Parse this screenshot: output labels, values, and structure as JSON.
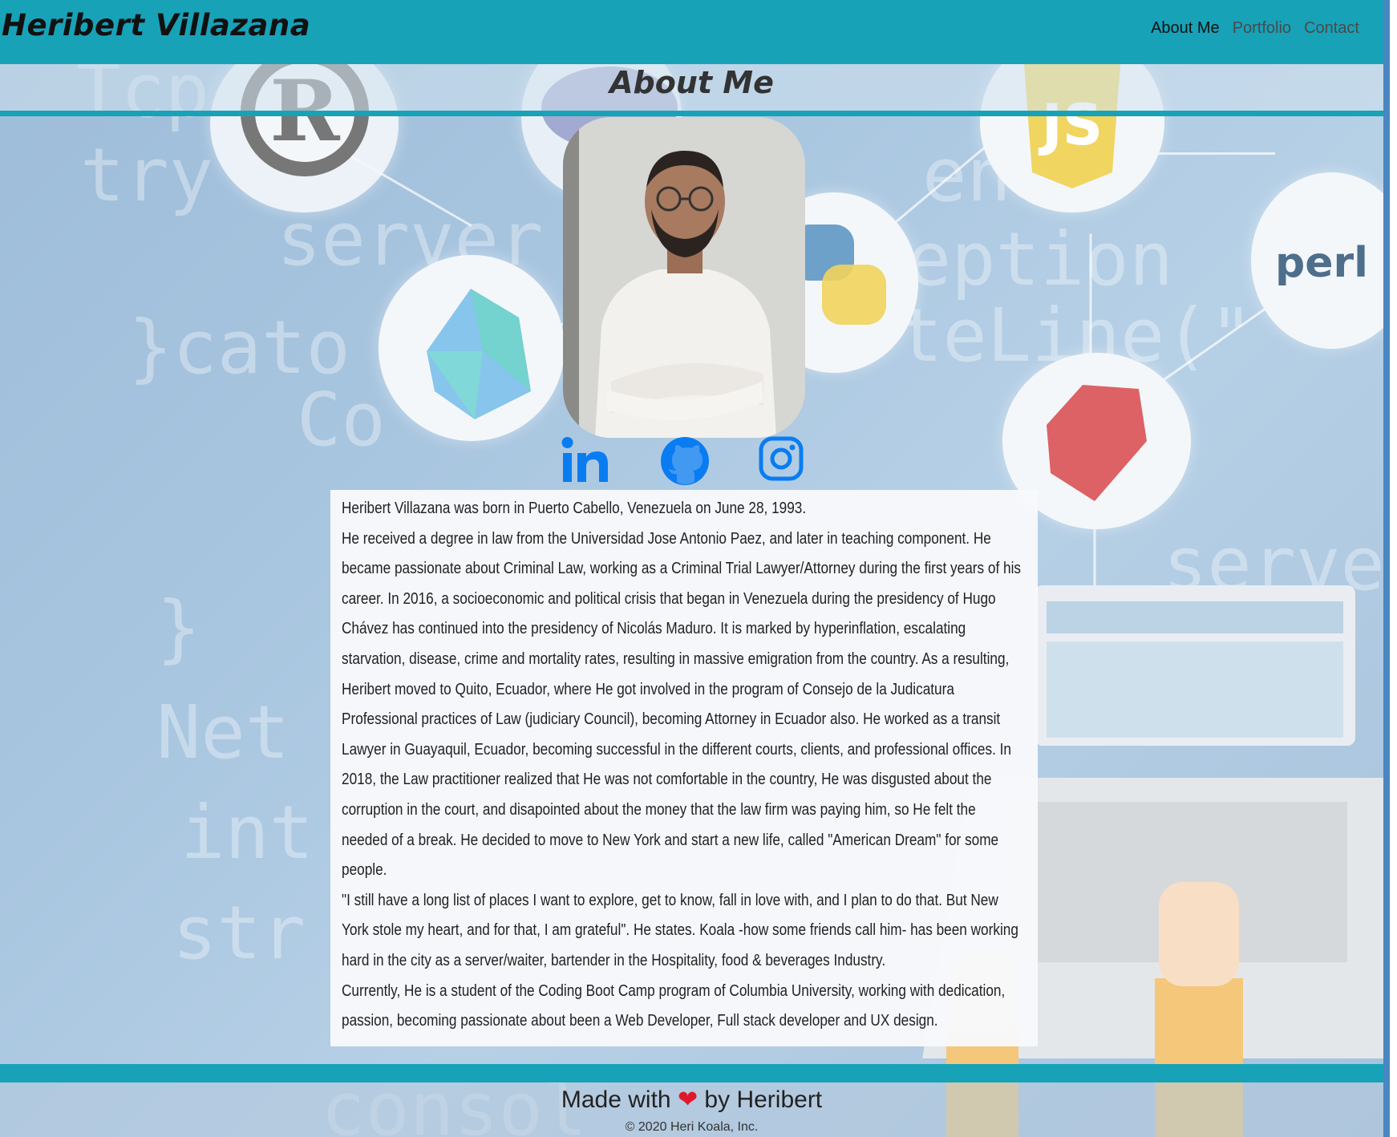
{
  "header": {
    "brand": "Heribert Villazana",
    "nav": [
      {
        "label": "About Me",
        "active": true
      },
      {
        "label": "Portfolio",
        "active": false
      },
      {
        "label": "Contact",
        "active": false
      }
    ]
  },
  "main": {
    "title": "About Me",
    "socials": [
      {
        "icon": "linkedin-icon"
      },
      {
        "icon": "github-icon"
      },
      {
        "icon": "instagram-icon"
      }
    ],
    "bio": [
      "Heribert Villazana was born in Puerto Cabello, Venezuela on June 28, 1993.",
      "He received a degree in law from the Universidad Jose Antonio Paez, and later in teaching component. He became passionate about Criminal Law, working as a Criminal Trial Lawyer/Attorney during the first years of his career. In 2016, a socioeconomic and political crisis that began in Venezuela during the presidency of Hugo Chávez has continued into the presidency of Nicolás Maduro. It is marked by hyperinflation, escalating starvation, disease, crime and mortality rates, resulting in massive emigration from the country. As a resulting, Heribert moved to Quito, Ecuador, where He got involved in the program of Consejo de la Judicatura Professional practices of Law (judiciary Council), becoming Attorney in Ecuador also. He worked as a transit Lawyer in Guayaquil, Ecuador, becoming successful in the different courts, clients, and professional offices. In 2018, the Law practitioner realized that He was not comfortable in the country, He was disgusted about the corruption in the court, and disapointed about the money that the law firm was paying him, so He felt the needed of a break. He decided to move to New York and start a new life, called \"American Dream\" for some people.",
      "\"I still have a long list of places I want to explore, get to know, fall in love with, and I plan to do that. But New York stole my heart, and for that, I am grateful\". He states. Koala -how some friends call him- has been working hard in the city as a server/waiter, bartender in the Hospitality, food & beverages Industry.",
      "Currently, He is a student of the Coding Boot Camp program of Columbia University, working with dedication, passion, becoming passionate about been a Web Developer, Full stack developer and UX design."
    ]
  },
  "footer": {
    "made_prefix": "Made with",
    "heart": "❤",
    "made_suffix": "by Heribert",
    "copyright": "© 2020 Heri Koala, Inc."
  },
  "colors": {
    "accent": "#17a2b8",
    "social_blue": "#0a7cf2"
  }
}
